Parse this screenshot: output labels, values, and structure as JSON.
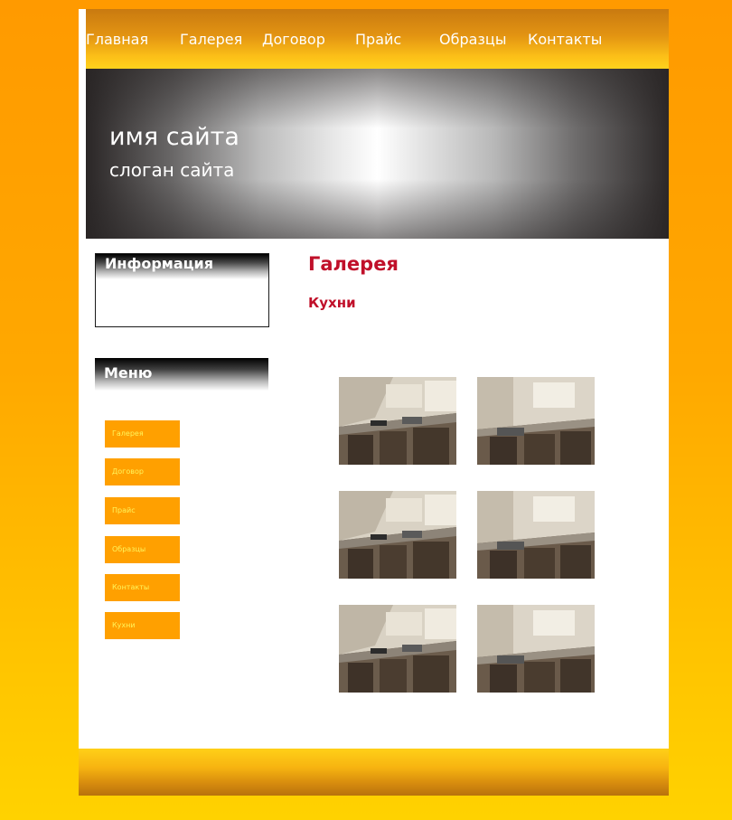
{
  "nav": {
    "items": [
      {
        "label": "Главная"
      },
      {
        "label": "Галерея"
      },
      {
        "label": "Договор"
      },
      {
        "label": "Прайс"
      },
      {
        "label": "Образцы"
      },
      {
        "label": "Контакты"
      }
    ]
  },
  "banner": {
    "site_name": "имя сайта",
    "slogan": "слоган сайта"
  },
  "sidebar": {
    "info_title": "Информация",
    "menu_title": "Меню",
    "menu_items": [
      {
        "label": "Галерея"
      },
      {
        "label": "Договор"
      },
      {
        "label": "Прайс"
      },
      {
        "label": "Образцы"
      },
      {
        "label": "Контакты"
      },
      {
        "label": "Кухни"
      }
    ]
  },
  "main": {
    "title": "Галерея",
    "subtitle": "Кухни",
    "photos": [
      {
        "name": "kitchen-photo"
      },
      {
        "name": "kitchen-photo"
      },
      {
        "name": "kitchen-photo"
      },
      {
        "name": "kitchen-photo"
      },
      {
        "name": "kitchen-photo"
      },
      {
        "name": "kitchen-photo"
      }
    ]
  },
  "colors": {
    "accent_red": "#c0102a",
    "menu_orange": "#ffa000",
    "menu_text": "#fff45a"
  }
}
